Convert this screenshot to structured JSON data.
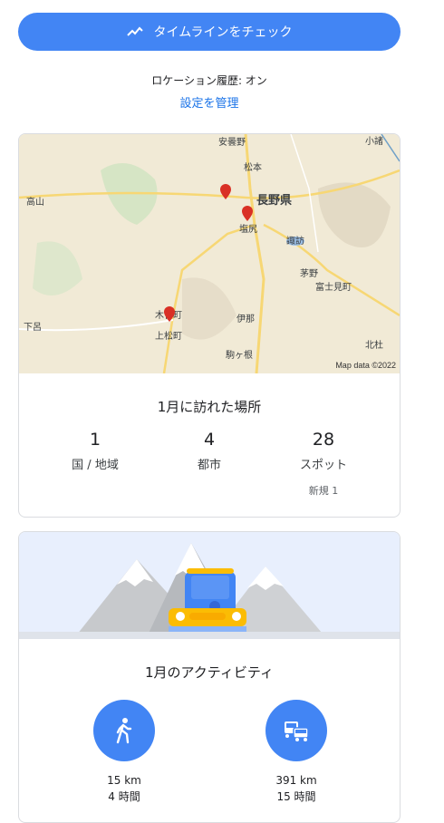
{
  "header": {
    "timeline_button_label": "タイムラインをチェック",
    "history_status": "ロケーション履歴: オン",
    "manage_settings_link": "設定を管理"
  },
  "places_card": {
    "map": {
      "labels": [
        "安曇野",
        "松本",
        "小諸",
        "長野県",
        "塩尻",
        "諏訪",
        "高山",
        "茅野",
        "富士見町",
        "木曽町",
        "上松町",
        "伊那",
        "下呂",
        "北杜",
        "駒ヶ根"
      ],
      "credit": "Map data ©2022",
      "pin_color": "#d93025"
    },
    "title": "1月に訪れた場所",
    "stats": [
      {
        "value": "1",
        "label": "国 / 地域"
      },
      {
        "value": "4",
        "label": "都市"
      },
      {
        "value": "28",
        "label": "スポット",
        "sub": "新規 1"
      }
    ]
  },
  "activity_card": {
    "title": "1月のアクティビティ",
    "activities": [
      {
        "icon": "walking-icon",
        "distance": "15 km",
        "duration": "4 時間"
      },
      {
        "icon": "driving-icon",
        "distance": "391 km",
        "duration": "15 時間"
      }
    ]
  },
  "colors": {
    "accent": "#4285f4",
    "link": "#1a73e8"
  }
}
